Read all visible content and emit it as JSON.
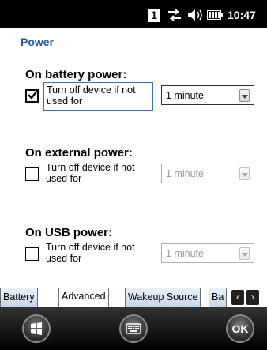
{
  "status_bar": {
    "notification_count": "1",
    "connection_icon": "sync-arrows-icon",
    "volume_icon": "speaker-icon",
    "battery_icon": "battery-icon",
    "time": "10:47"
  },
  "page": {
    "title": "Power"
  },
  "sections": [
    {
      "heading": "On battery power:",
      "checkbox_label": "Turn off device if not used for",
      "checked": true,
      "dropdown_value": "1 minute",
      "enabled": true
    },
    {
      "heading": "On external power:",
      "checkbox_label": "Turn off device if not used for",
      "checked": false,
      "dropdown_value": "1 minute",
      "enabled": false
    },
    {
      "heading": "On USB power:",
      "checkbox_label": "Turn off device if not used for",
      "checked": false,
      "dropdown_value": "1 minute",
      "enabled": false
    }
  ],
  "tabs": [
    {
      "label": "Battery",
      "active": false
    },
    {
      "label": "Advanced",
      "active": true
    },
    {
      "label": "Wakeup Source",
      "active": false
    },
    {
      "label": "Ba",
      "active": false
    }
  ],
  "tab_scroll": {
    "left": "‹",
    "right": "›"
  },
  "bottom_bar": {
    "start_icon": "windows-start-icon",
    "keyboard_icon": "keyboard-icon",
    "ok_label": "OK"
  },
  "colors": {
    "title": "#1f5aa6",
    "focus_border": "#3c6fb6",
    "tab_gradient": "#c7d6ea"
  }
}
